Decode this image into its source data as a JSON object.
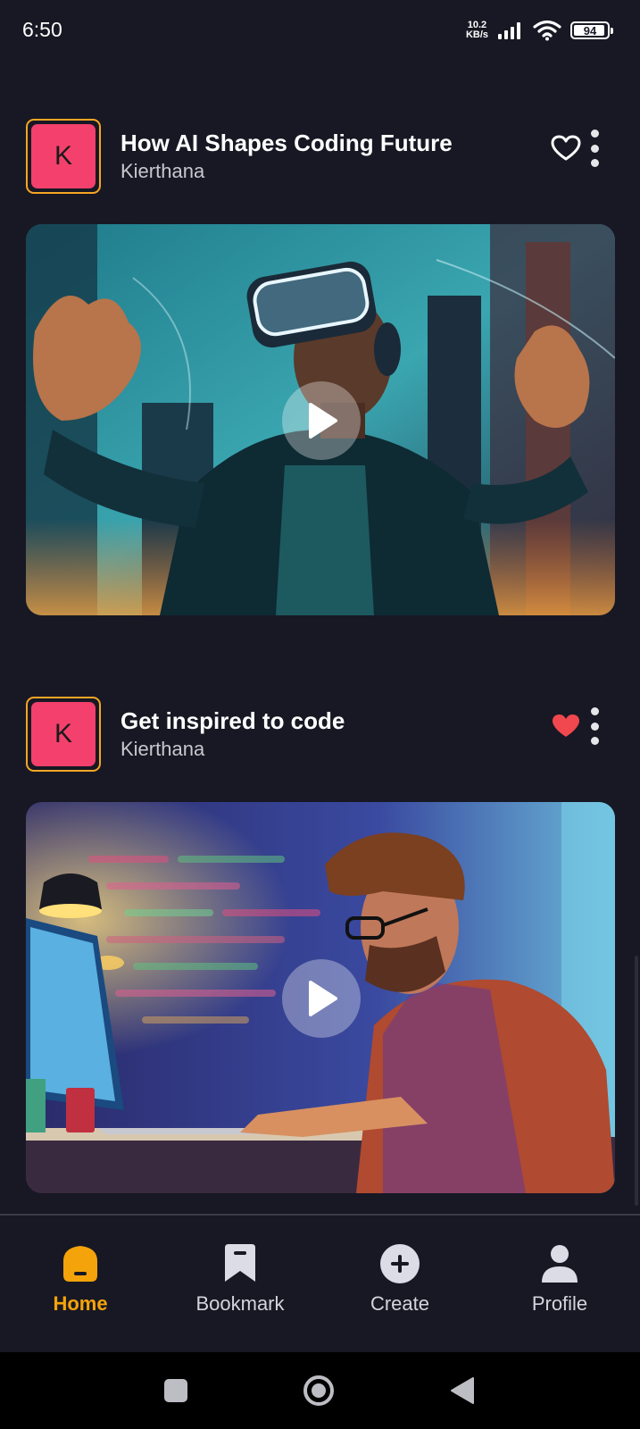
{
  "status_bar": {
    "time": "6:50",
    "net_speed_value": "10.2",
    "net_speed_unit": "KB/s",
    "battery": "94",
    "battery_level": 0.94
  },
  "posts": [
    {
      "avatar_letter": "K",
      "title": "How AI Shapes Coding Future",
      "author": "Kierthana",
      "liked": false,
      "image": "vr-headset-man-city"
    },
    {
      "avatar_letter": "K",
      "title": "Get inspired to code",
      "author": "Kierthana",
      "liked": true,
      "image": "programmer-at-computer"
    }
  ],
  "bottom_nav": {
    "items": [
      {
        "label": "Home",
        "icon": "home-icon",
        "active": true
      },
      {
        "label": "Bookmark",
        "icon": "bookmark-icon",
        "active": false
      },
      {
        "label": "Create",
        "icon": "plus-circle-icon",
        "active": false
      },
      {
        "label": "Profile",
        "icon": "profile-icon",
        "active": false
      }
    ]
  },
  "colors": {
    "background": "#181824",
    "accent": "#f5a30a",
    "avatar": "#f4406c",
    "liked_heart": "#f0484e"
  }
}
